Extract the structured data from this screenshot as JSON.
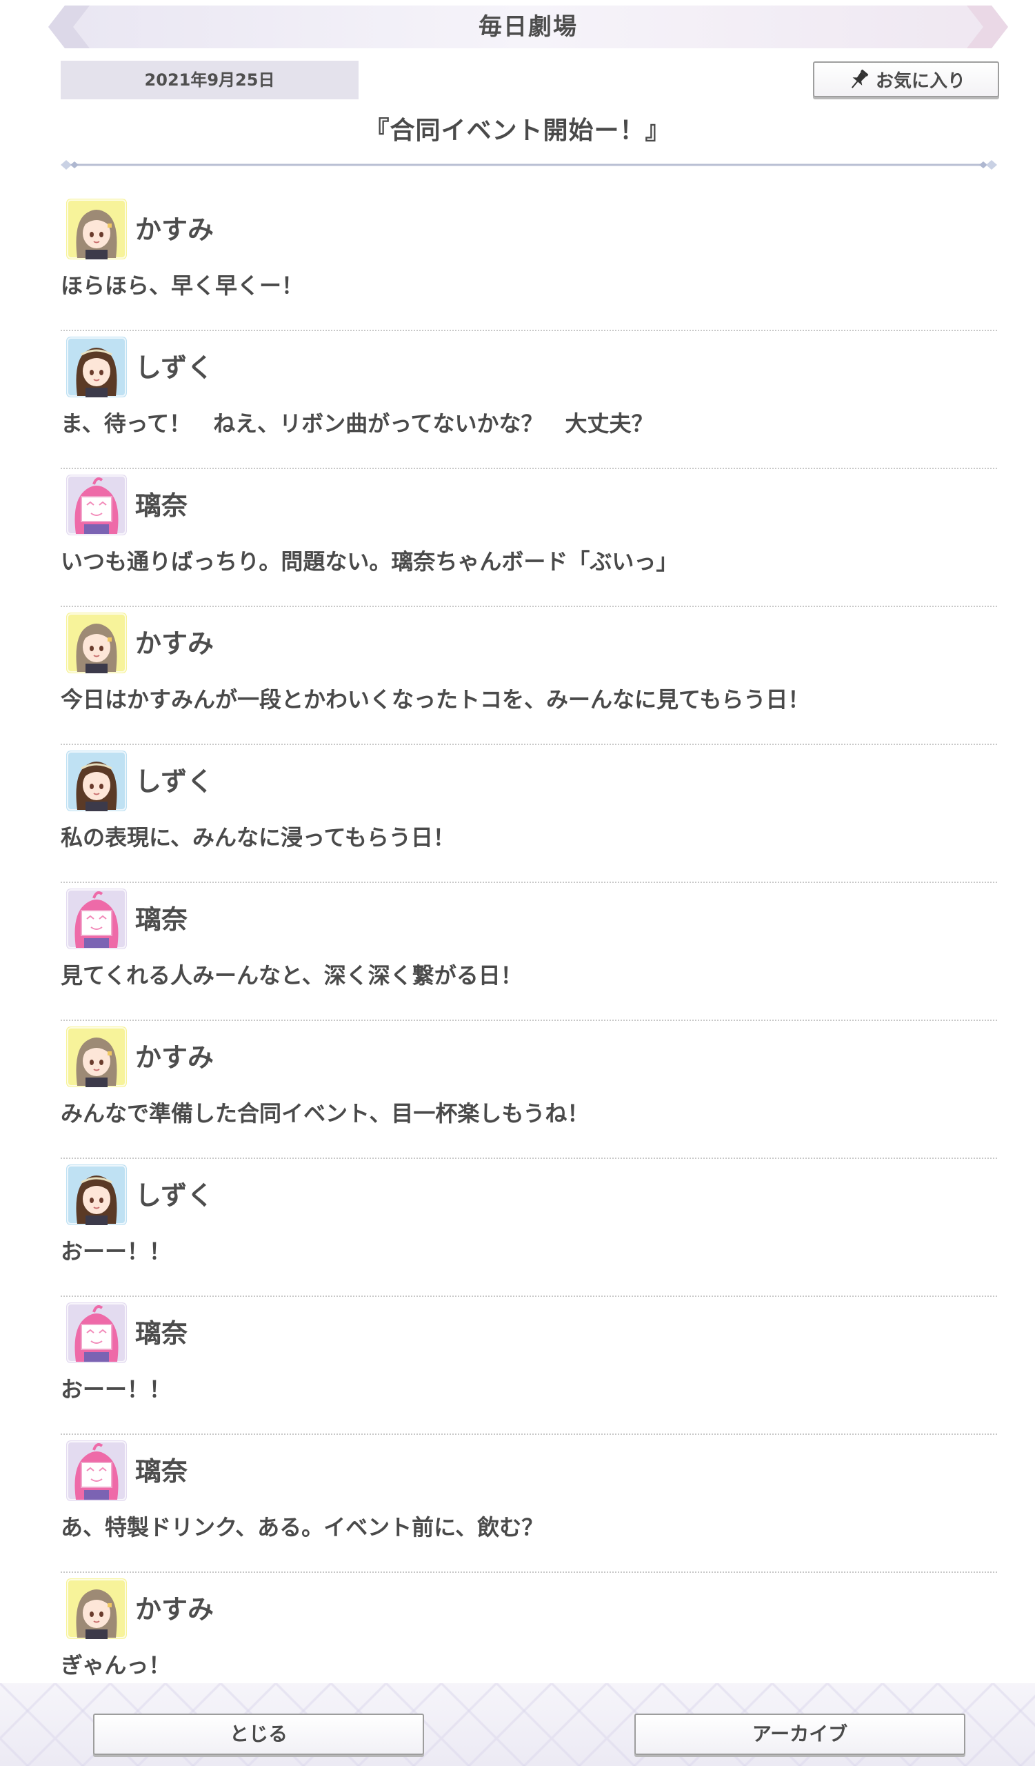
{
  "header": {
    "title": "毎日劇場"
  },
  "date": "2021年9月25日",
  "favorite": {
    "label": "お気に入り",
    "icon": "pin-icon"
  },
  "story": {
    "title": "『合同イベント開始ー！』"
  },
  "characters": {
    "kasumi": {
      "name": "かすみ",
      "bg": "#f7f39a",
      "hair": "#9d8a75"
    },
    "shizuku": {
      "name": "しずく",
      "bg": "#bfe1f3",
      "hair": "#5b3a26"
    },
    "rina": {
      "name": "璃奈",
      "bg": "#e3dbf0",
      "hair": "#ee6aa8"
    }
  },
  "dialog": [
    {
      "speaker": "かすみ",
      "character": "kasumi",
      "text": "ほらほら、早く早くー！"
    },
    {
      "speaker": "しずく",
      "character": "shizuku",
      "text": "ま、待って！　ねえ、リボン曲がってないかな？　大丈夫？"
    },
    {
      "speaker": "璃奈",
      "character": "rina",
      "text": "いつも通りばっちり。問題ない。璃奈ちゃんボード「ぶいっ」"
    },
    {
      "speaker": "かすみ",
      "character": "kasumi",
      "text": "今日はかすみんが一段とかわいくなったトコを、みーんなに見てもらう日！"
    },
    {
      "speaker": "しずく",
      "character": "shizuku",
      "text": "私の表現に、みんなに浸ってもらう日！"
    },
    {
      "speaker": "璃奈",
      "character": "rina",
      "text": "見てくれる人みーんなと、深く深く繋がる日！"
    },
    {
      "speaker": "かすみ",
      "character": "kasumi",
      "text": "みんなで準備した合同イベント、目一杯楽しもうね！"
    },
    {
      "speaker": "しずく",
      "character": "shizuku",
      "text": "おーー！！"
    },
    {
      "speaker": "璃奈",
      "character": "rina",
      "text": "おーー！！"
    },
    {
      "speaker": "璃奈",
      "character": "rina",
      "text": "あ、特製ドリンク、ある。イベント前に、飲む？"
    },
    {
      "speaker": "かすみ",
      "character": "kasumi",
      "text": "ぎゃんっ！"
    }
  ],
  "footer": {
    "close_label": "とじる",
    "archive_label": "アーカイブ"
  }
}
